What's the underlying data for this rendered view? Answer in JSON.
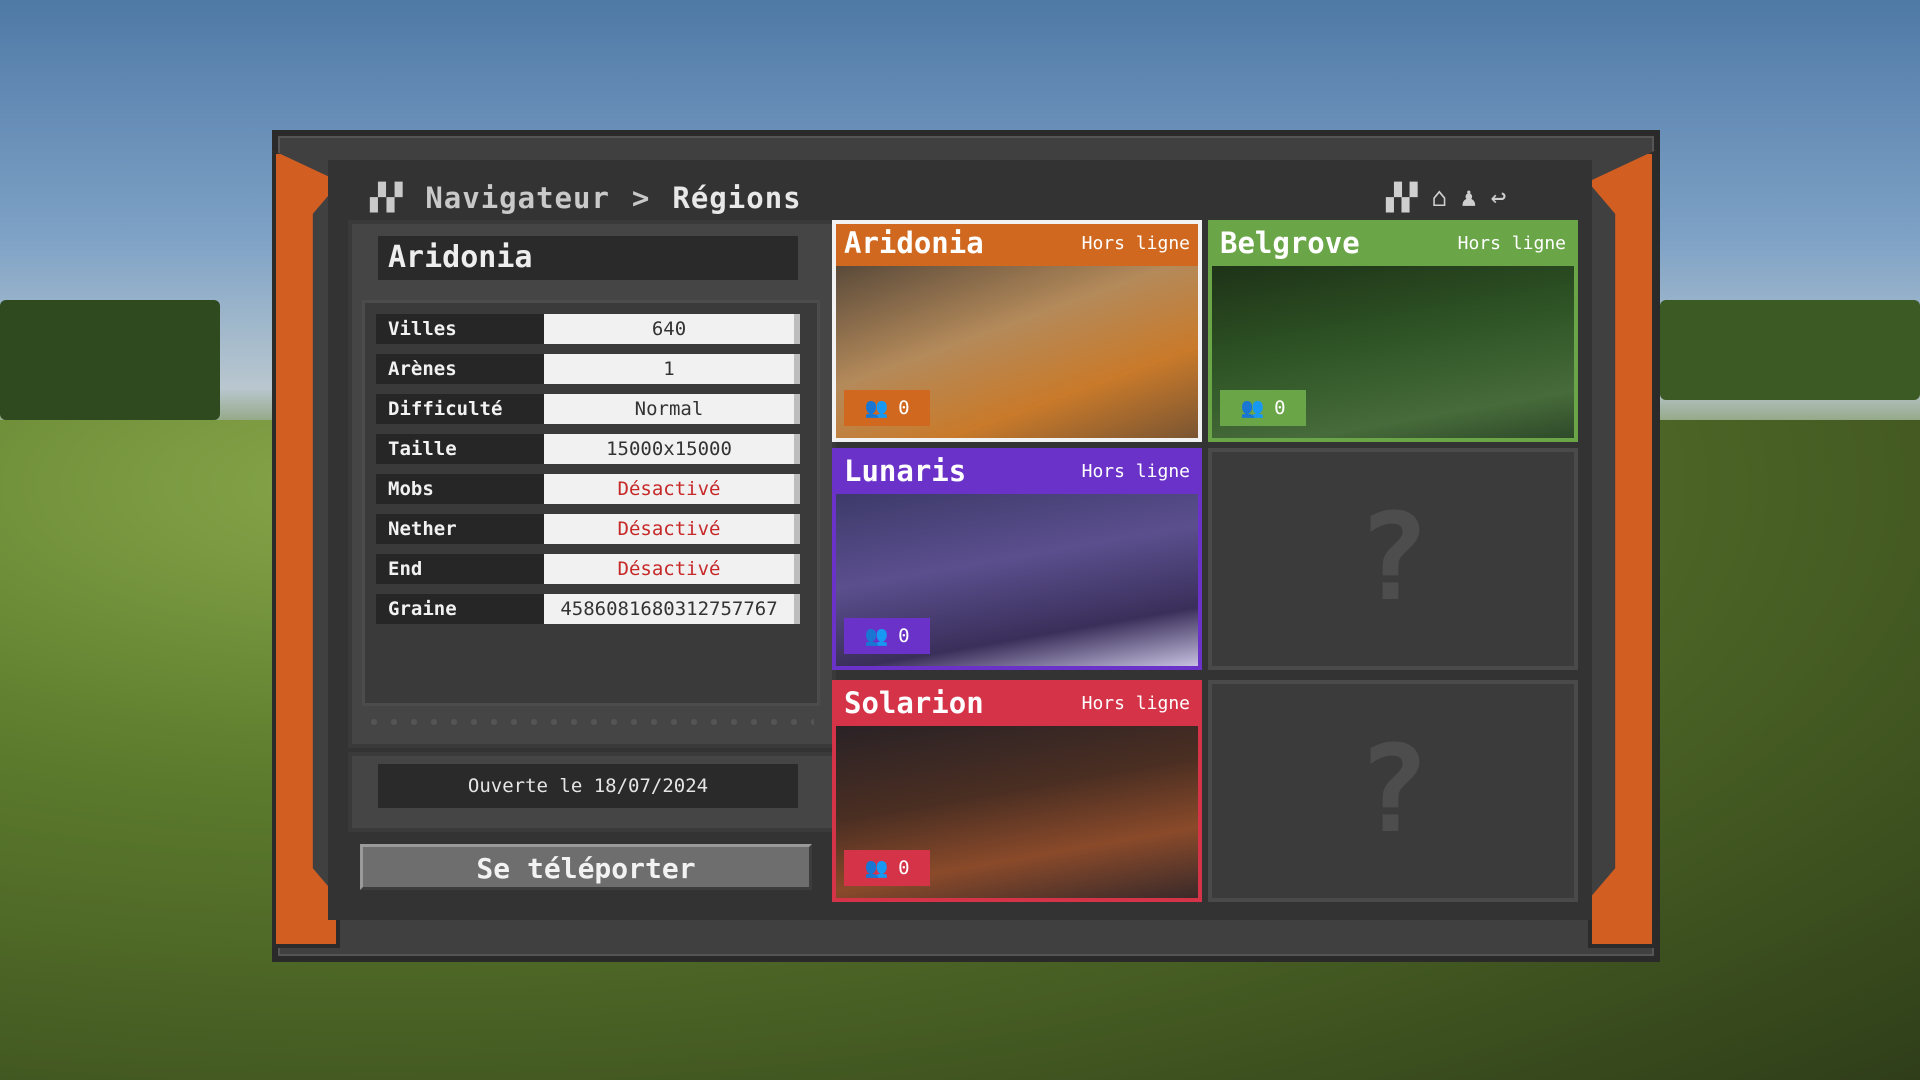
{
  "header": {
    "crumb_root": "Navigateur",
    "separator": ">",
    "crumb_current": "Régions",
    "icons": [
      "map-icon",
      "home-icon",
      "profile-icon",
      "back-icon"
    ]
  },
  "region": {
    "name": "Aridonia",
    "stats": [
      {
        "label": "Villes",
        "value": "640"
      },
      {
        "label": "Arènes",
        "value": "1"
      },
      {
        "label": "Difficulté",
        "value": "Normal"
      },
      {
        "label": "Taille",
        "value": "15000x15000"
      },
      {
        "label": "Mobs",
        "value": "Désactivé"
      },
      {
        "label": "Nether",
        "value": "Désactivé"
      },
      {
        "label": "End",
        "value": "Désactivé"
      },
      {
        "label": "Graine",
        "value": "4586081680312757767"
      }
    ],
    "opened": "Ouverte le 18/07/2024",
    "teleport_label": "Se téléporter"
  },
  "cards": [
    {
      "name": "Aridonia",
      "status": "Hors ligne",
      "players": "0",
      "color": "#d0691f"
    },
    {
      "name": "Belgrove",
      "status": "Hors ligne",
      "players": "0",
      "color": "#6aa548"
    },
    {
      "name": "Lunaris",
      "status": "Hors ligne",
      "players": "0",
      "color": "#6a32c8"
    },
    {
      "name": "Solarion",
      "status": "Hors ligne",
      "players": "0",
      "color": "#d43348"
    }
  ],
  "empty_slot_label": "?"
}
